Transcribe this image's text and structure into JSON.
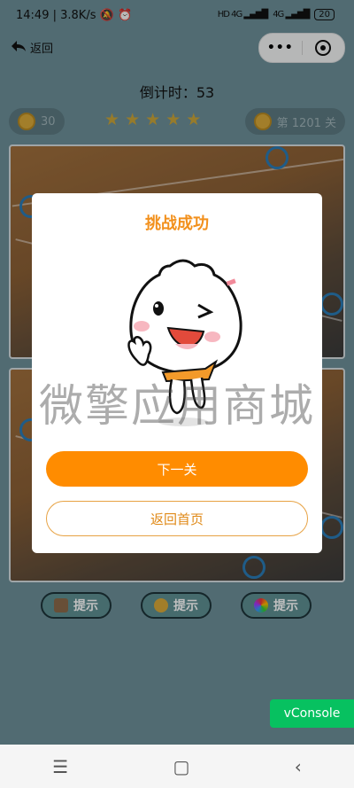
{
  "status_bar": {
    "time": "14:49",
    "network_speed": "3.8K/s",
    "signal_1": "HD 4G",
    "signal_2": "4G",
    "battery": "20"
  },
  "nav": {
    "back_label": "返回",
    "more_glyph": "•••"
  },
  "game": {
    "countdown_label": "倒计时：",
    "countdown_value": "53",
    "coins": "30",
    "stars_glyph": "★ ★ ★ ★ ★",
    "level": "第 1201 关"
  },
  "modal": {
    "title": "挑战成功",
    "next_button": "下一关",
    "home_button": "返回首页"
  },
  "watermark": "微擎应用商城",
  "hints": [
    {
      "label": "提示",
      "icon": "tv-icon"
    },
    {
      "label": "提示",
      "icon": "coins-icon"
    },
    {
      "label": "提示",
      "icon": "color-wheel-icon"
    }
  ],
  "vconsole_label": "vConsole",
  "system_nav": {
    "menu": "☰",
    "home": "▢",
    "back": "‹"
  }
}
